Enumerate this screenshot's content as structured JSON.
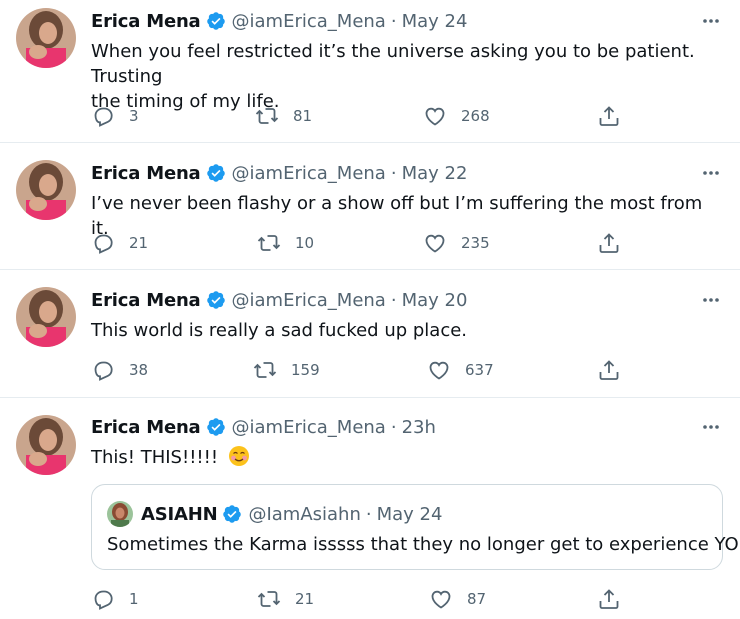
{
  "colors": {
    "text": "#0f1419",
    "muted": "#536471",
    "verified": "#1d9bf0",
    "divider": "#e6ecf0",
    "border": "#cfd9de"
  },
  "tweets": [
    {
      "name": "Erica Mena",
      "handle": "@iamErica_Mena",
      "separator": "·",
      "date": "May 24",
      "text_line1": "When you feel restricted it’s the universe asking you to be patient. Trusting",
      "text_line2": "the timing of my life.",
      "replies": "3",
      "retweets": "81",
      "likes": "268"
    },
    {
      "name": "Erica Mena",
      "handle": "@iamErica_Mena",
      "separator": "·",
      "date": "May 22",
      "text_line1": "I’ve never been flashy or a show off but  I’m suffering the most from it.",
      "replies": "21",
      "retweets": "10",
      "likes": "235"
    },
    {
      "name": "Erica Mena",
      "handle": "@iamErica_Mena",
      "separator": "·",
      "date": "May 20",
      "text_line1": "This world is really a sad fucked up place.",
      "replies": "38",
      "retweets": "159",
      "likes": "637"
    },
    {
      "name": "Erica Mena",
      "handle": "@iamErica_Mena",
      "separator": "·",
      "date": "23h",
      "text_line1": "This! THIS!!!!!",
      "emoji": "smiling-face-with-blush-icon",
      "replies": "1",
      "retweets": "21",
      "likes": "87",
      "quote": {
        "name": "ASIAHN",
        "handle": "@IamAsiahn",
        "separator": "·",
        "date": "May 24",
        "text": "Sometimes the Karma isssss that they no longer get to experience YOU."
      }
    }
  ],
  "icons": {
    "reply": "reply-icon",
    "retweet": "retweet-icon",
    "like": "like-icon",
    "share": "share-icon",
    "more": "more-icon",
    "verified": "verified-badge-icon"
  }
}
